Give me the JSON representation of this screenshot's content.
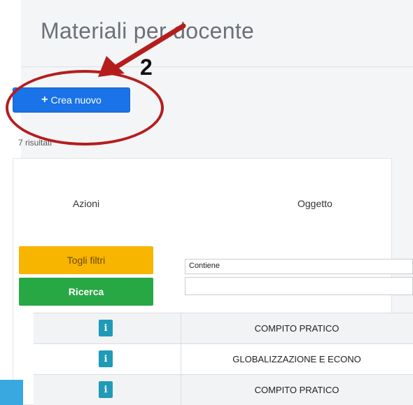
{
  "page": {
    "title": "Materiali per docente",
    "create_button_label": "Crea nuovo",
    "results_count_text": "7 risultati"
  },
  "annotation": {
    "step_number": "2",
    "accent_color": "#b51d1d"
  },
  "table": {
    "headers": {
      "actions": "Azioni",
      "object": "Oggetto"
    },
    "filters": {
      "reset_label": "Togli filtri",
      "search_label": "Ricerca",
      "object_filter_mode": "Contiene",
      "object_filter_value": ""
    },
    "rows": [
      {
        "action_icon": "info-icon",
        "action_glyph": "i",
        "object": "COMPITO PRATICO"
      },
      {
        "action_icon": "info-icon",
        "action_glyph": "i",
        "object": "GLOBALIZZAZIONE E ECONO"
      },
      {
        "action_icon": "info-icon",
        "action_glyph": "i",
        "object": "COMPITO PRATICO"
      }
    ]
  },
  "colors": {
    "primary": "#1a73e8",
    "warning": "#f7b500",
    "success": "#28a745",
    "info": "#1f9bb7"
  }
}
